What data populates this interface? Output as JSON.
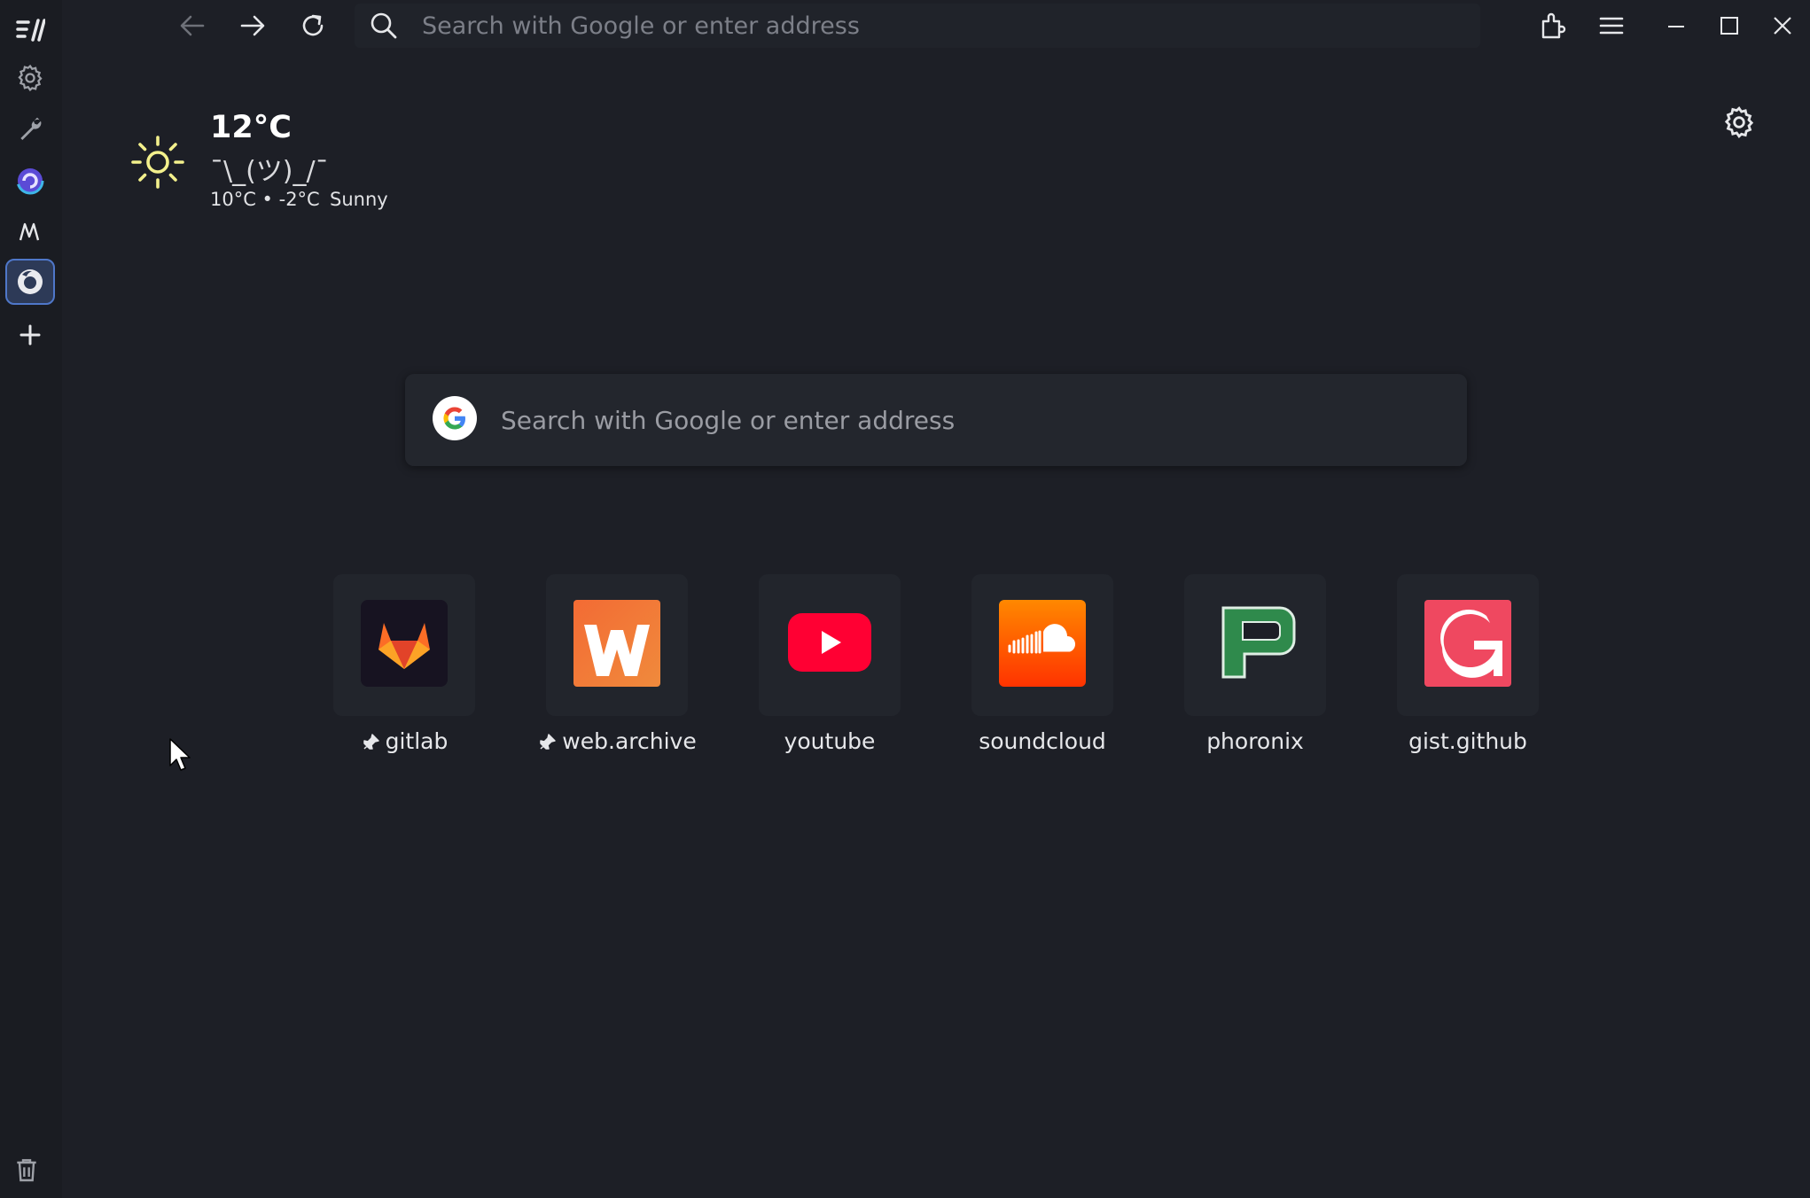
{
  "toolbar": {
    "urlbar_placeholder": "Search with Google or enter address",
    "icons": [
      "app-menu-icon",
      "back-arrow-icon",
      "forward-arrow-icon",
      "reload-icon",
      "search-icon",
      "extensions-icon",
      "hamburger-menu-icon",
      "minimize-icon",
      "maximize-icon",
      "close-icon"
    ]
  },
  "sidebar": {
    "items": [
      "settings-gear-icon",
      "wrench-icon",
      "browser-logo-icon",
      "m-logo-icon",
      "firefox-logo-icon",
      "add-icon"
    ],
    "active_index": 4,
    "bottom": "trash-icon"
  },
  "weather": {
    "temp": "12°C",
    "shrug": "¯\\_(ツ)_/¯",
    "range": "10°C • -2°C",
    "condition": "Sunny"
  },
  "search": {
    "placeholder": "Search with Google or enter address"
  },
  "top_sites": [
    {
      "label": "gitlab",
      "pinned": true,
      "icon": "gitlab-logo-icon"
    },
    {
      "label": "web.archive",
      "pinned": true,
      "icon": "web-archive-logo-icon"
    },
    {
      "label": "youtube",
      "pinned": false,
      "icon": "youtube-logo-icon"
    },
    {
      "label": "soundcloud",
      "pinned": false,
      "icon": "soundcloud-logo-icon"
    },
    {
      "label": "phoronix",
      "pinned": false,
      "icon": "phoronix-logo-icon"
    },
    {
      "label": "gist.github",
      "pinned": false,
      "icon": "gist-github-logo-icon"
    }
  ],
  "colors": {
    "background": "#1d1f26",
    "sidebar_active": "#4f77c9",
    "youtube": "#ff0033",
    "soundcloud": "#ff5500",
    "gist": "#ef4860",
    "phoronix": "#2f8a4c",
    "gitlab": "#fc6d26",
    "web_archive": "#f16a3a"
  }
}
